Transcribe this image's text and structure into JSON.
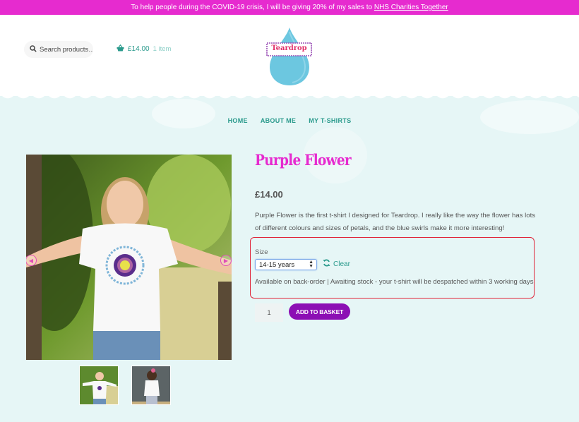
{
  "announcement": {
    "text": "To help people during the COVID-19 crisis, I will be giving 20% of my sales to ",
    "link_label": "NHS Charities Together"
  },
  "header": {
    "search_placeholder": "Search products…",
    "cart_total": "£14.00",
    "cart_count": "1 item",
    "logo_text": "Teardrop"
  },
  "nav": {
    "items": [
      {
        "label": "HOME"
      },
      {
        "label": "ABOUT ME"
      },
      {
        "label": "MY T-SHIRTS"
      }
    ]
  },
  "product": {
    "title": "Purple Flower",
    "price": "£14.00",
    "description": "Purple Flower is the first t-shirt I designed for Teardrop. I really like the way the flower has lots of different colours and sizes of petals, and the blue swirls make it more interesting!",
    "size_label": "Size",
    "size_selected": "14-15 years",
    "clear_label": "Clear",
    "stock_text": "Available on back-order | Awaiting stock - your t-shirt will be despatched within 3 working days",
    "quantity": "1",
    "add_to_basket_label": "ADD TO BASKET"
  },
  "gallery": {
    "main_image": "girl-in-purple-flower-tshirt-photo",
    "thumbnails": [
      "thumbnail-front-view",
      "thumbnail-back-view"
    ]
  },
  "colors": {
    "brand_pink": "#e62bcf",
    "accent_teal": "#2a9a8c",
    "button_purple": "#8c0fb4",
    "highlight_red": "#e0263a"
  }
}
